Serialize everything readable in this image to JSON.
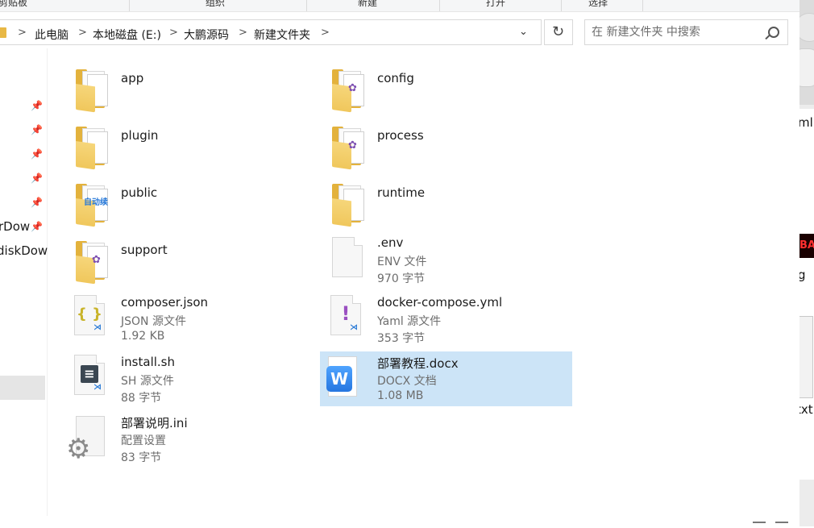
{
  "ribbon": {
    "groups": [
      "剪贴板",
      "组织",
      "新建",
      "打开",
      "选择"
    ]
  },
  "address": {
    "crumbs": [
      "此电脑",
      "本地磁盘 (E:)",
      "大鹏源码",
      "新建文件夹"
    ],
    "separator": ">",
    "dropdown_glyph": "⌄",
    "refresh_glyph": "↻"
  },
  "search": {
    "placeholder": "在 新建文件夹 中搜索"
  },
  "nav": {
    "items": [
      "rDow",
      "diskDow"
    ],
    "pin_glyph": "📌"
  },
  "desktop": {
    "labels": [
      "ml",
      "g",
      "txt"
    ],
    "red_badge": "BA"
  },
  "files": [
    {
      "name": "app",
      "type": "folder",
      "mark": ""
    },
    {
      "name": "config",
      "type": "folder",
      "mark": "✿"
    },
    {
      "name": "plugin",
      "type": "folder",
      "mark": ""
    },
    {
      "name": "process",
      "type": "folder",
      "mark": "✿"
    },
    {
      "name": "public",
      "type": "folder",
      "mark": "自动续"
    },
    {
      "name": "runtime",
      "type": "folder",
      "mark": ""
    },
    {
      "name": "support",
      "type": "folder",
      "mark": "✿"
    },
    {
      "name": ".env",
      "type": "file",
      "kind": "ENV 文件",
      "size": "970 字节"
    },
    {
      "name": "composer.json",
      "type": "file",
      "kind": "JSON 源文件",
      "size": "1.92 KB",
      "glyph": "{ }"
    },
    {
      "name": "docker-compose.yml",
      "type": "file",
      "kind": "Yaml 源文件",
      "size": "353 字节",
      "glyph": "!"
    },
    {
      "name": "install.sh",
      "type": "file",
      "kind": "SH 源文件",
      "size": "88 字节",
      "glyph": "≡"
    },
    {
      "name": "部署教程.docx",
      "type": "file",
      "kind": "DOCX 文档",
      "size": "1.08 MB",
      "glyph": "W",
      "selected": true
    },
    {
      "name": "部署说明.ini",
      "type": "file",
      "kind": "配置设置",
      "size": "83 字节",
      "glyph": "⚙"
    }
  ],
  "colors": {
    "selection": "#cce4f7",
    "folder": "#e3b23c",
    "accent_blue": "#2676e0"
  }
}
